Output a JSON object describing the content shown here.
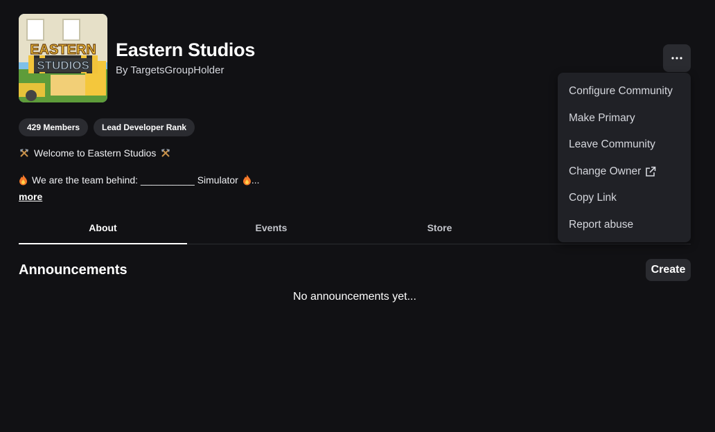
{
  "community": {
    "name": "Eastern Studios",
    "byline": "By TargetsGroupHolder",
    "logo_text_top": "EASTERN",
    "logo_text_bottom": "STUDIOS"
  },
  "badges": [
    "429 Members",
    "Lead Developer Rank"
  ],
  "description": {
    "line1": "Welcome to Eastern Studios",
    "line2": "We are the team behind: __________ Simulator",
    "line2_suffix": "...",
    "more_label": "more"
  },
  "tabs": [
    {
      "label": "About",
      "active": true
    },
    {
      "label": "Events",
      "active": false
    },
    {
      "label": "Store",
      "active": false
    }
  ],
  "announcements": {
    "title": "Announcements",
    "create_label": "Create",
    "empty_text": "No announcements yet..."
  },
  "menu": {
    "items": [
      {
        "label": "Configure Community"
      },
      {
        "label": "Make Primary"
      },
      {
        "label": "Leave Community"
      },
      {
        "label": "Change Owner",
        "icon": "external-link-icon"
      },
      {
        "label": "Copy Link"
      },
      {
        "label": "Report abuse"
      }
    ]
  },
  "icons": {
    "more_button": "ellipsis-icon",
    "decor": "hammer-pick-icon",
    "flame": "fire-icon"
  },
  "colors": {
    "background": "#111114",
    "surface": "#2a2b30",
    "menu_bg": "#202126",
    "text": "#ffffff",
    "muted": "#d5d7dd"
  }
}
